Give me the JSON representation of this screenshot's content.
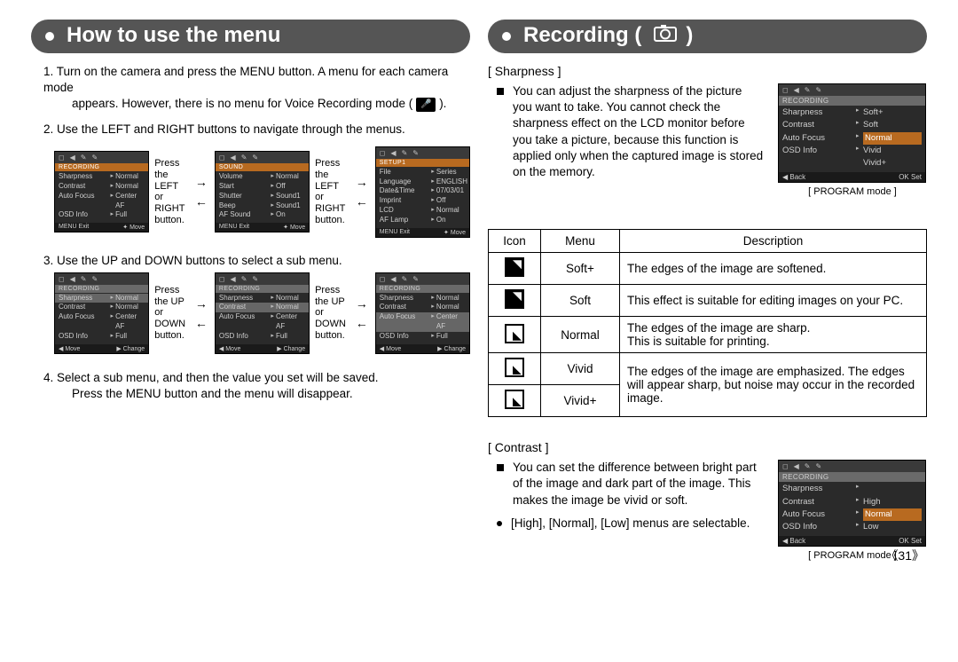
{
  "left": {
    "title": "How to use the menu",
    "step1a": "1. Turn on the camera and press the MENU button. A menu for each camera mode",
    "step1b": "appears. However, there is no menu for Voice Recording mode (",
    "step1c": ").",
    "step2": "2. Use the LEFT and RIGHT buttons to navigate through the menus.",
    "press_lr": "Press the LEFT or RIGHT button.",
    "step3": "3. Use the UP and DOWN buttons to select a sub menu.",
    "press_ud": "Press the UP or DOWN button.",
    "step4a": "4. Select a sub menu, and then the value you set will be saved.",
    "step4b": "Press the MENU button and the menu will disappear.",
    "menu_rec_head": "RECORDING",
    "menu_sound_head": "SOUND",
    "menu_setup_head": "SETUP1",
    "rec_rows": [
      {
        "k": "Sharpness",
        "v": "Normal"
      },
      {
        "k": "Contrast",
        "v": "Normal"
      },
      {
        "k": "Auto Focus",
        "v": "Center AF"
      },
      {
        "k": "OSD Info",
        "v": "Full"
      }
    ],
    "sound_rows": [
      {
        "k": "Volume",
        "v": "Normal"
      },
      {
        "k": "Start",
        "v": "Off"
      },
      {
        "k": "Shutter",
        "v": "Sound1"
      },
      {
        "k": "Beep",
        "v": "Sound1"
      },
      {
        "k": "AF Sound",
        "v": "On"
      }
    ],
    "setup_rows": [
      {
        "k": "File",
        "v": "Series"
      },
      {
        "k": "Language",
        "v": "ENGLISH"
      },
      {
        "k": "Date&Time",
        "v": "07/03/01"
      },
      {
        "k": "Imprint",
        "v": "Off"
      },
      {
        "k": "LCD",
        "v": "Normal"
      },
      {
        "k": "AF Lamp",
        "v": "On"
      }
    ],
    "foot_exit": "MENU  Exit",
    "foot_move": "Move",
    "foot_move2": "◀  Move",
    "foot_change": "▶  Change"
  },
  "right": {
    "title": "Recording (",
    "title_end": ")",
    "sharp_label": "[ Sharpness ]",
    "sharp_text": "You can adjust the sharpness of the picture you want to take. You cannot check the sharpness effect on the LCD monitor before you take a picture, because this function is applied only when the captured image is stored on the memory.",
    "caption": "[ PROGRAM mode ]",
    "sharp_menu_rows": [
      {
        "k": "Sharpness",
        "v": "Soft+"
      },
      {
        "k": "Contrast",
        "v": "Soft"
      },
      {
        "k": "Auto Focus",
        "v": "Normal",
        "hl": true
      },
      {
        "k": "OSD Info",
        "v": "Vivid"
      },
      {
        "k": "",
        "v": "Vivid+"
      }
    ],
    "foot_back": "◀  Back",
    "foot_set": "OK  Set",
    "table": {
      "headers": [
        "Icon",
        "Menu",
        "Description"
      ],
      "rows": [
        {
          "menu": "Soft+",
          "desc": "The edges of the image are softened."
        },
        {
          "menu": "Soft",
          "desc": "This effect is suitable for editing images on your PC."
        },
        {
          "menu": "Normal",
          "desc": "The edges of the image are sharp.\nThis is suitable for printing."
        },
        {
          "menu": "Vivid",
          "desc": "The edges of the image are emphasized. The edges"
        },
        {
          "menu": "Vivid+",
          "desc": "will appear sharp, but noise may occur in the recorded image."
        }
      ]
    },
    "contrast_label": "[ Contrast ]",
    "contrast_text": "You can set the difference between bright part of the image and dark part of the image. This makes the image be vivid or soft.",
    "contrast_bullet": "[High], [Normal], [Low] menus are selectable.",
    "contrast_menu_rows": [
      {
        "k": "Sharpness",
        "v": ""
      },
      {
        "k": "Contrast",
        "v": "High"
      },
      {
        "k": "Auto Focus",
        "v": "Normal",
        "hl": true
      },
      {
        "k": "OSD Info",
        "v": "Low"
      }
    ]
  },
  "page_number": "《31》"
}
